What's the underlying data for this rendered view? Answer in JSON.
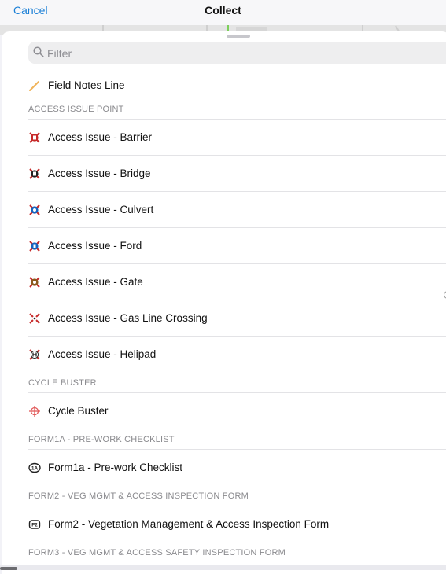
{
  "nav": {
    "cancel": "Cancel",
    "title": "Collect"
  },
  "filter": {
    "placeholder": "Filter"
  },
  "colors": {
    "accent": "#1a7fd6",
    "red": "#c62828",
    "blue": "#1565c0",
    "orange": "#f0b35a",
    "brown": "#8a5a1e"
  },
  "list": {
    "rows": [
      {
        "kind": "item",
        "label": "Field Notes Line",
        "icon": "line-icon"
      },
      {
        "kind": "section",
        "label": "ACCESS ISSUE POINT"
      },
      {
        "kind": "item",
        "label": "Access Issue - Barrier",
        "icon": "barrier-icon"
      },
      {
        "kind": "item",
        "label": "Access Issue - Bridge",
        "icon": "bridge-icon"
      },
      {
        "kind": "item",
        "label": "Access Issue - Culvert",
        "icon": "culvert-icon"
      },
      {
        "kind": "item",
        "label": "Access Issue - Ford",
        "icon": "ford-icon"
      },
      {
        "kind": "item",
        "label": "Access Issue - Gate",
        "icon": "gate-icon"
      },
      {
        "kind": "item",
        "label": "Access Issue - Gas Line Crossing",
        "icon": "gas-line-icon"
      },
      {
        "kind": "item",
        "label": "Access Issue - Helipad",
        "icon": "helipad-icon"
      },
      {
        "kind": "section",
        "label": "CYCLE BUSTER"
      },
      {
        "kind": "item",
        "label": "Cycle Buster",
        "icon": "crosshair-icon"
      },
      {
        "kind": "section",
        "label": "FORM1A - PRE-WORK CHECKLIST"
      },
      {
        "kind": "item",
        "label": "Form1a - Pre-work Checklist",
        "icon": "form-1a-icon"
      },
      {
        "kind": "section",
        "label": "FORM2 - VEG MGMT & ACCESS INSPECTION FORM"
      },
      {
        "kind": "item",
        "label": "Form2 - Vegetation Management & Access Inspection Form",
        "icon": "form-2-icon"
      },
      {
        "kind": "section",
        "label": "FORM3 - VEG MGMT & ACCESS SAFETY INSPECTION FORM"
      }
    ]
  }
}
